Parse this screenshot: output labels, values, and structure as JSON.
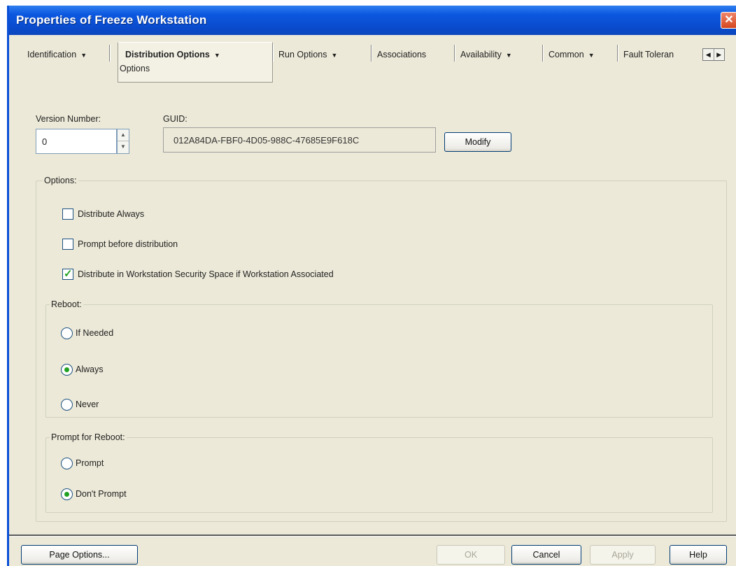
{
  "window": {
    "title": "Properties of Freeze Workstation"
  },
  "tabs": [
    {
      "label": "Identification",
      "dropdown": true
    },
    {
      "label": "Distribution Options",
      "dropdown": true,
      "active": true
    },
    {
      "label": "Run Options",
      "dropdown": true
    },
    {
      "label": "Associations",
      "dropdown": false
    },
    {
      "label": "Availability",
      "dropdown": true
    },
    {
      "label": "Common",
      "dropdown": true
    },
    {
      "label": "Fault Toleran",
      "dropdown": false
    }
  ],
  "active_subtab": "Options",
  "fields": {
    "version_label": "Version Number:",
    "version_value": "0",
    "guid_label": "GUID:",
    "guid_value": "012A84DA-FBF0-4D05-988C-47685E9F618C",
    "modify_label": "Modify"
  },
  "options_group": {
    "label": "Options:",
    "checkboxes": [
      {
        "label": "Distribute Always",
        "checked": false
      },
      {
        "label": "Prompt before distribution",
        "checked": false
      },
      {
        "label": "Distribute in Workstation Security Space if Workstation Associated",
        "checked": true
      }
    ]
  },
  "reboot_group": {
    "label": "Reboot:",
    "options": [
      {
        "label": "If Needed",
        "selected": false
      },
      {
        "label": "Always",
        "selected": true
      },
      {
        "label": "Never",
        "selected": false
      }
    ]
  },
  "prompt_reboot_group": {
    "label": "Prompt for Reboot:",
    "options": [
      {
        "label": "Prompt",
        "selected": false
      },
      {
        "label": "Don't Prompt",
        "selected": true
      }
    ]
  },
  "buttons": {
    "page_options": "Page Options...",
    "ok": "OK",
    "cancel": "Cancel",
    "apply": "Apply",
    "help": "Help"
  },
  "colors": {
    "titlebar": "#0a4ccf",
    "dialog_bg": "#ece9d8",
    "check_mark": "#21a121"
  }
}
